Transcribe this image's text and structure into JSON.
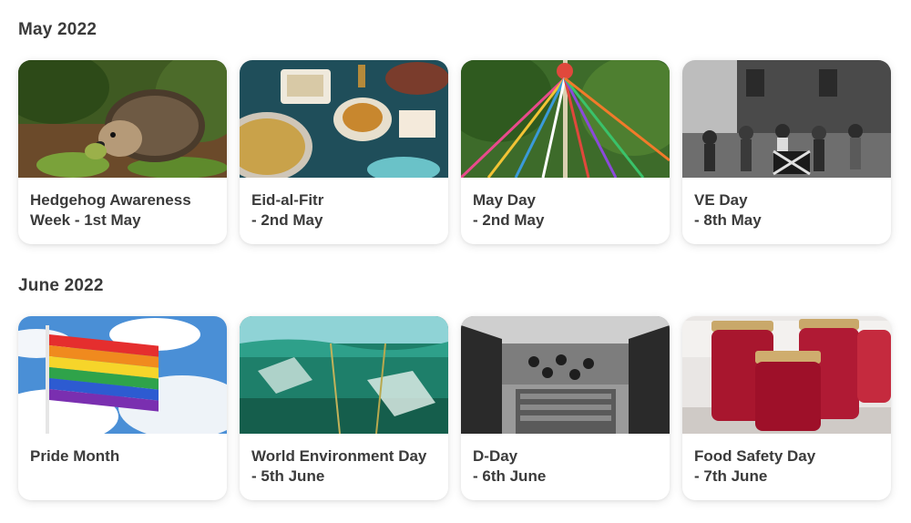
{
  "sections": [
    {
      "heading": "May 2022",
      "cards": [
        {
          "line1": "Hedgehog Awareness",
          "line2": "Week - 1st May",
          "image": "hedgehog-image"
        },
        {
          "line1": "Eid-al-Fitr",
          "line2": "- 2nd May",
          "image": "eid-sweets-image"
        },
        {
          "line1": "May Day",
          "line2": "- 2nd May",
          "image": "maypole-image"
        },
        {
          "line1": "VE Day",
          "line2": "- 8th May",
          "image": "ve-day-street-party-image"
        }
      ]
    },
    {
      "heading": "June 2022",
      "cards": [
        {
          "line1": "Pride Month",
          "line2": "",
          "image": "rainbow-flag-image"
        },
        {
          "line1": "World Environment Day",
          "line2": "- 5th June",
          "image": "ocean-plastic-image"
        },
        {
          "line1": "D-Day",
          "line2": "- 6th June",
          "image": "landing-craft-image"
        },
        {
          "line1": "Food Safety Day",
          "line2": "- 7th June",
          "image": "jam-jars-image"
        }
      ]
    }
  ]
}
